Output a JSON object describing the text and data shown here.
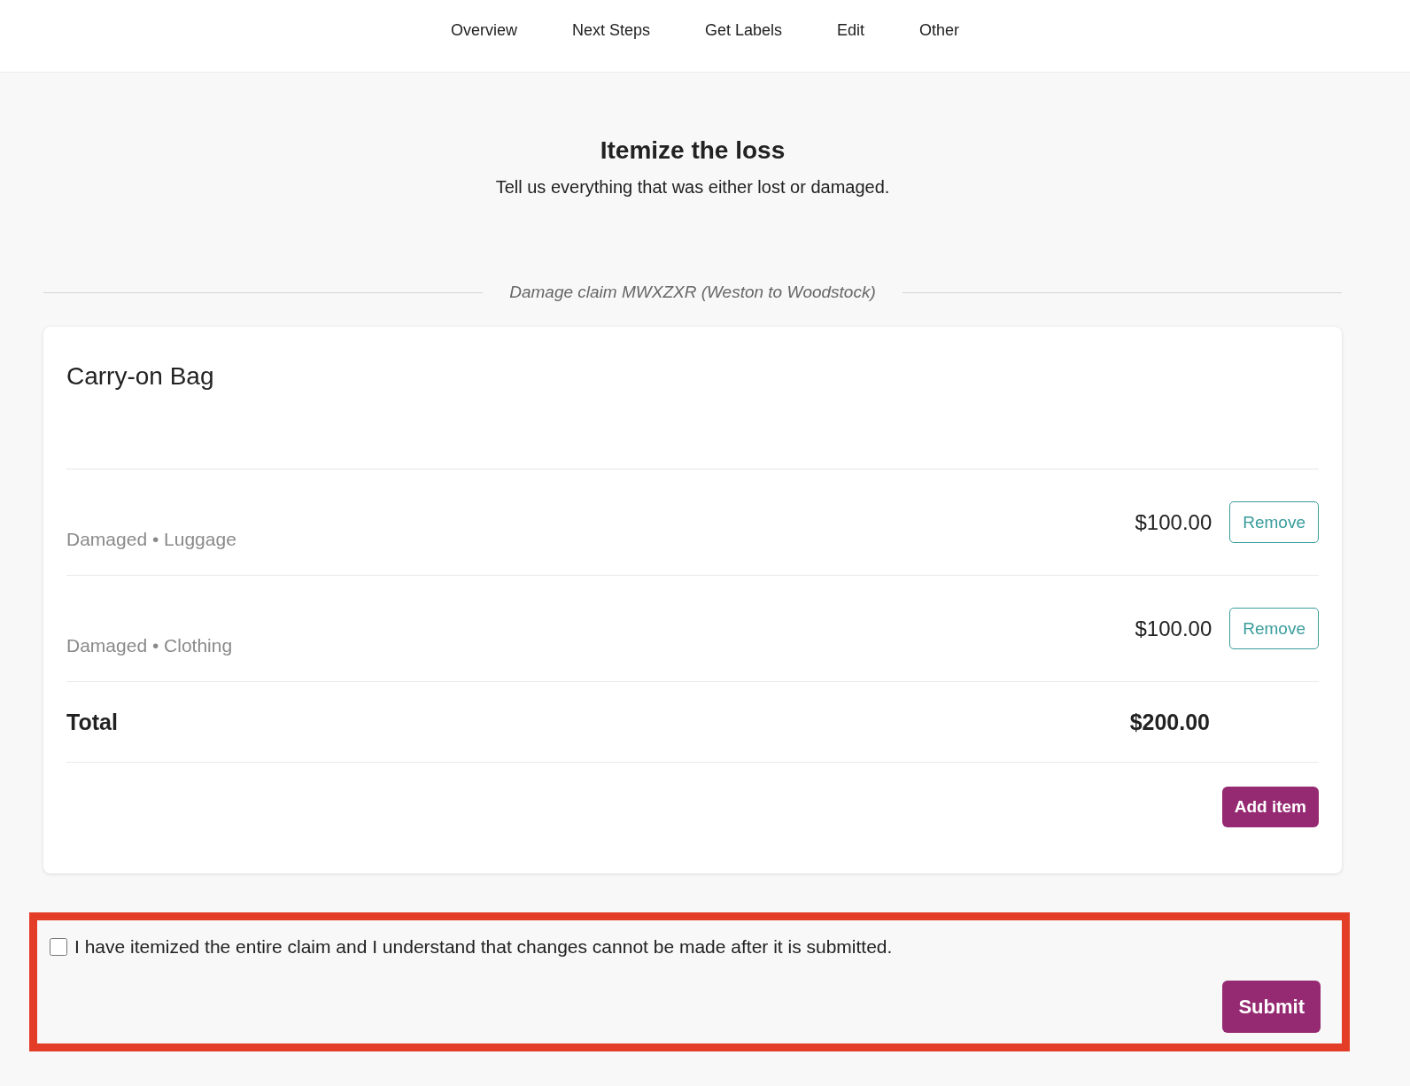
{
  "nav": {
    "items": [
      {
        "label": "Overview"
      },
      {
        "label": "Next Steps"
      },
      {
        "label": "Get Labels"
      },
      {
        "label": "Edit"
      },
      {
        "label": "Other"
      }
    ]
  },
  "header": {
    "title": "Itemize the loss",
    "subtitle": "Tell us everything that was either lost or damaged."
  },
  "claim_label": "Damage claim MWXZXR (Weston to Woodstock)",
  "card": {
    "title": "Carry-on Bag",
    "items": [
      {
        "tag": "Damaged • Luggage",
        "amount": "$100.00",
        "action": "Remove"
      },
      {
        "tag": "Damaged • Clothing",
        "amount": "$100.00",
        "action": "Remove"
      }
    ],
    "total_label": "Total",
    "total": "$200.00",
    "add_button": "Add item"
  },
  "confirmation": {
    "checked": false,
    "text": "I have itemized the entire claim and I understand that changes cannot be made after it is submitted.",
    "submit": "Submit",
    "highlighted": true
  }
}
